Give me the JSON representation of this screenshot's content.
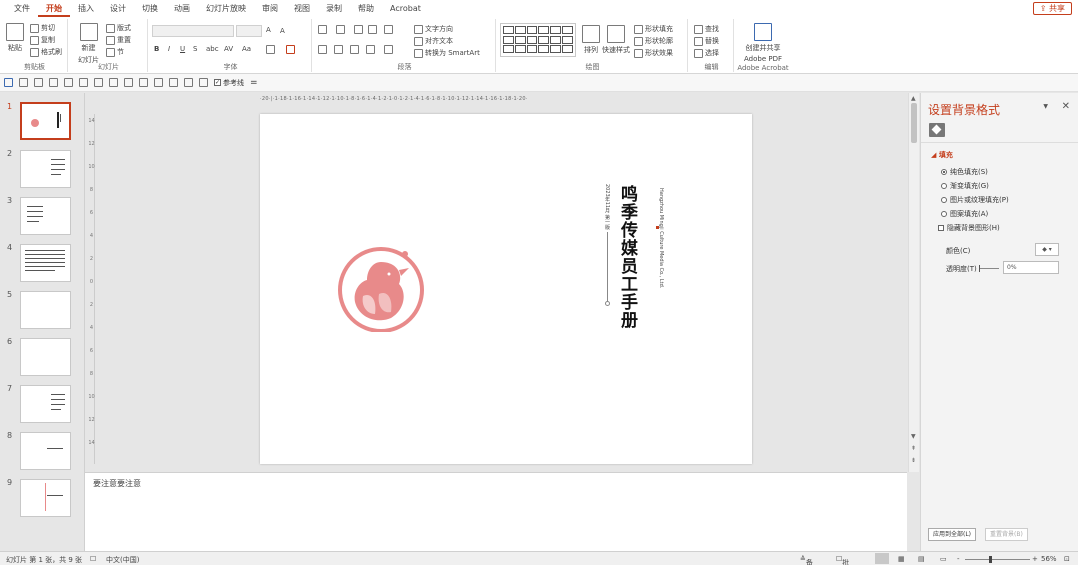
{
  "menu": {
    "tabs": [
      "文件",
      "开始",
      "插入",
      "设计",
      "切换",
      "动画",
      "幻灯片放映",
      "审阅",
      "视图",
      "录制",
      "帮助",
      "Acrobat"
    ],
    "active_tab": "开始",
    "share": "共享"
  },
  "ribbon": {
    "clipboard": {
      "paste": "粘贴",
      "cut": "剪切",
      "copy": "复制",
      "format_painter": "格式刷",
      "label": "剪贴板"
    },
    "slides": {
      "new_slide": "新建",
      "new_slide2": "幻灯片",
      "layout": "版式",
      "reset": "重置",
      "section": "节",
      "label": "幻灯片"
    },
    "font": {
      "bold": "B",
      "italic": "I",
      "underline": "U",
      "strike": "S",
      "shadow": "abc",
      "spacing": "AV",
      "case": "Aa",
      "grow": "A",
      "shrink": "A",
      "label": "字体"
    },
    "paragraph": {
      "text_direction": "文字方向",
      "align_text": "对齐文本",
      "smartart": "转换为 SmartArt",
      "label": "段落"
    },
    "drawing": {
      "arrange": "排列",
      "quick_styles": "快速样式",
      "shape_fill": "形状填充",
      "shape_outline": "形状轮廓",
      "shape_effect": "形状效果",
      "label": "绘图"
    },
    "editing": {
      "find": "查找",
      "replace": "替换",
      "select": "选择",
      "label": "编辑"
    },
    "acrobat": {
      "create_share": "创建并共享",
      "adobe_pdf": "Adobe PDF",
      "label": "Adobe Acrobat"
    }
  },
  "qat": {
    "guides": "参考线"
  },
  "thumbnails": [
    {
      "num": "1"
    },
    {
      "num": "2"
    },
    {
      "num": "3"
    },
    {
      "num": "4"
    },
    {
      "num": "5"
    },
    {
      "num": "6"
    },
    {
      "num": "7"
    },
    {
      "num": "8"
    },
    {
      "num": "9"
    }
  ],
  "ruler": {
    "h": "·20·|·1·18·1·16·1·14·1·12·1·10·1·8·1·6·1·4·1·2·1·0·1·2·1·4·1·6·1·8·1·10·1·12·1·14·1·16·1·18·1·20·",
    "v": [
      "14",
      "12",
      "10",
      "8",
      "6",
      "4",
      "2",
      "0",
      "2",
      "4",
      "6",
      "8",
      "10",
      "12",
      "14"
    ]
  },
  "slide": {
    "title": "鸣季传媒员工手册",
    "date": "2023年11月 第一版",
    "company_en": "Hangzhou Mingji Culture Media Co., Ltd."
  },
  "notes": {
    "text": "要注意要注意"
  },
  "format_pane": {
    "title": "设置背景格式",
    "section": "填充",
    "options": [
      "纯色填充(S)",
      "渐变填充(G)",
      "图片或纹理填充(P)",
      "图案填充(A)"
    ],
    "hide_graphics": "隐藏背景图形(H)",
    "color_label": "颜色(C)",
    "transparency_label": "透明度(T)",
    "transparency_value": "0%",
    "apply_all": "应用到全部(L)",
    "reset": "重置背景(B)"
  },
  "status": {
    "slide_info": "幻灯片 第 1 张，共 9 张",
    "language": "中文(中国)",
    "notes": "备注",
    "comments": "批注",
    "zoom": "56%"
  },
  "colors": {
    "accent": "#c43e1c",
    "logo": "#e88a8a"
  }
}
